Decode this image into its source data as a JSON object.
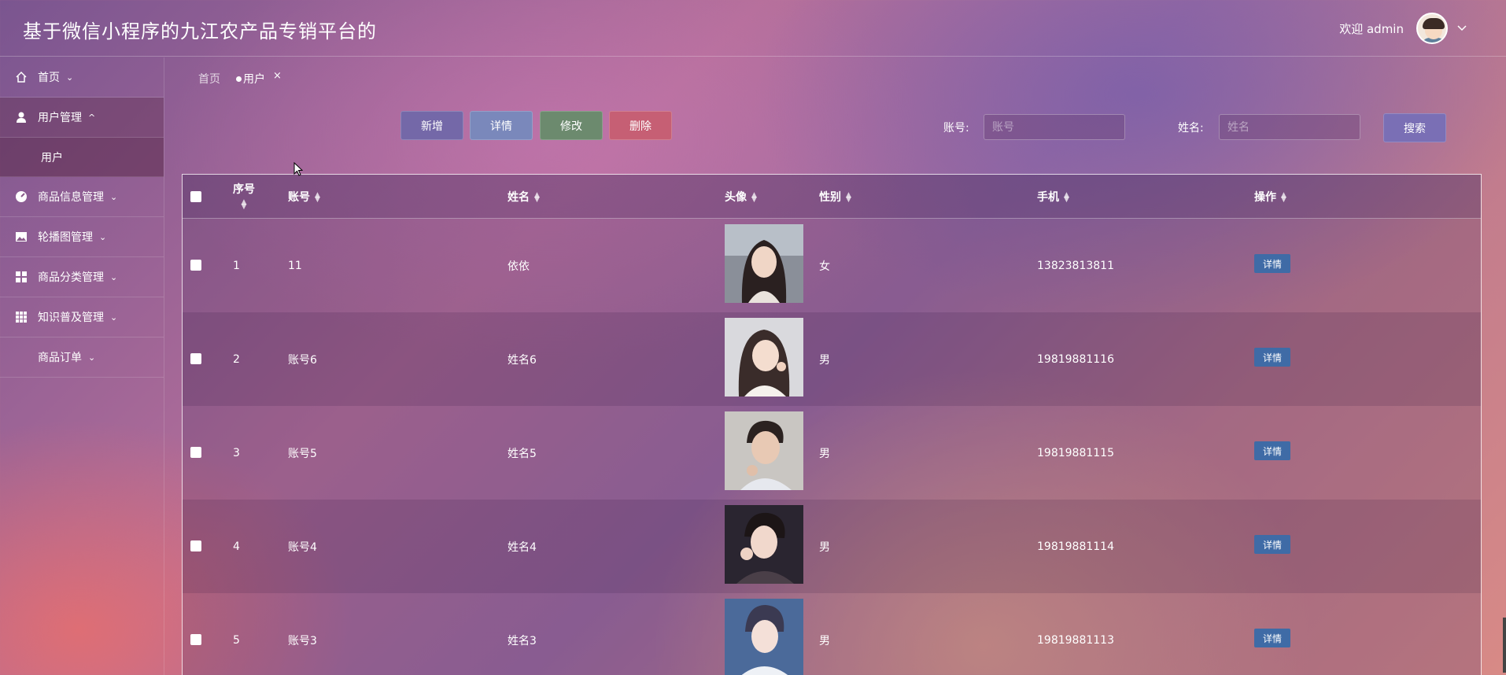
{
  "header": {
    "title": "基于微信小程序的九江农产品专销平台的",
    "welcome": "欢迎 admin"
  },
  "sidebar": {
    "items": [
      {
        "label": "首页",
        "icon": "home-icon"
      },
      {
        "label": "用户管理",
        "icon": "user-icon",
        "expanded": true
      },
      {
        "label": "商品信息管理",
        "icon": "gauge-icon"
      },
      {
        "label": "轮播图管理",
        "icon": "picture-icon"
      },
      {
        "label": "商品分类管理",
        "icon": "grid-icon"
      },
      {
        "label": "知识普及管理",
        "icon": "apps-icon"
      },
      {
        "label": "商品订单",
        "icon": ""
      }
    ],
    "submenu": {
      "label": "用户"
    }
  },
  "breadcrumb": {
    "home": "首页",
    "current": "用户",
    "close": "×"
  },
  "toolbar": {
    "add": "新增",
    "detail": "详情",
    "edit": "修改",
    "delete": "删除",
    "search": "搜索"
  },
  "filters": {
    "account_label": "账号:",
    "account_placeholder": "账号",
    "name_label": "姓名:",
    "name_placeholder": "姓名"
  },
  "table": {
    "columns": [
      "序号",
      "账号",
      "姓名",
      "头像",
      "性别",
      "手机",
      "操作"
    ],
    "rows": [
      {
        "seq": "1",
        "account": "11",
        "name": "依依",
        "gender": "女",
        "phone": "13823813811",
        "action": "详情"
      },
      {
        "seq": "2",
        "account": "账号6",
        "name": "姓名6",
        "gender": "男",
        "phone": "19819881116",
        "action": "详情"
      },
      {
        "seq": "3",
        "account": "账号5",
        "name": "姓名5",
        "gender": "男",
        "phone": "19819881115",
        "action": "详情"
      },
      {
        "seq": "4",
        "account": "账号4",
        "name": "姓名4",
        "gender": "男",
        "phone": "19819881114",
        "action": "详情"
      },
      {
        "seq": "5",
        "account": "账号3",
        "name": "姓名3",
        "gender": "男",
        "phone": "19819881113",
        "action": "详情"
      }
    ]
  }
}
